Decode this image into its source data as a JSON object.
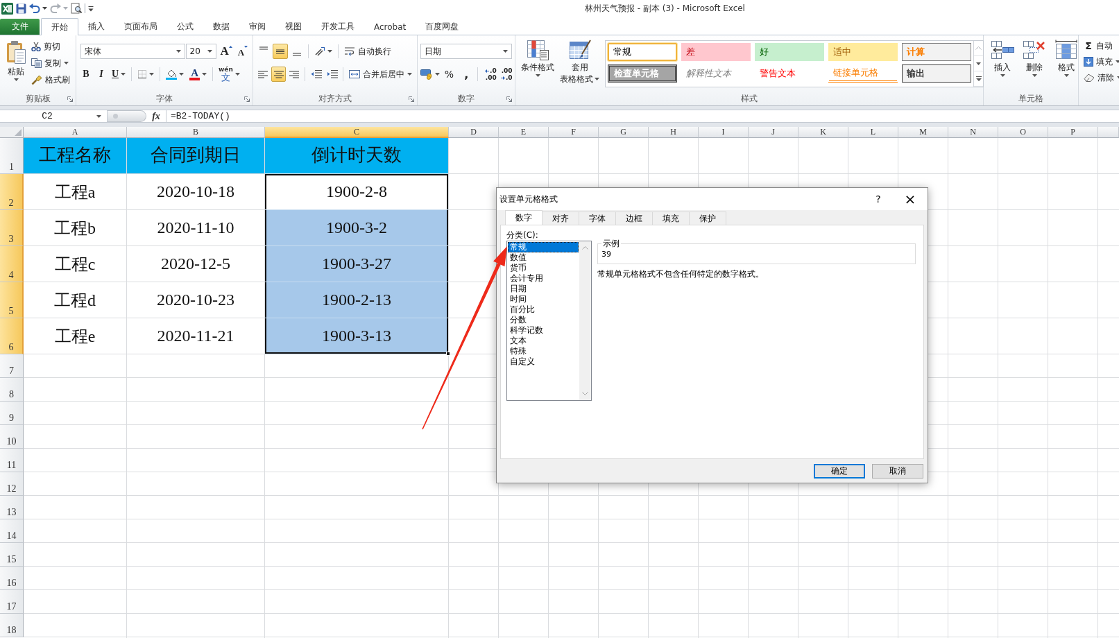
{
  "window": {
    "title": "林州天气预报 - 副本 (3)  -  Microsoft Excel"
  },
  "quick_access_toolbar": [
    {
      "kind": "save",
      "disabled": false
    },
    {
      "kind": "undo",
      "disabled": false
    },
    {
      "kind": "redo",
      "disabled": true
    },
    {
      "kind": "print_preview",
      "disabled": false
    }
  ],
  "ribbon_tabs": [
    {
      "label": "文件",
      "kind": "file",
      "selected": false
    },
    {
      "label": "开始",
      "kind": "tab",
      "selected": true
    },
    {
      "label": "插入",
      "kind": "tab",
      "selected": false
    },
    {
      "label": "页面布局",
      "kind": "tab",
      "selected": false
    },
    {
      "label": "公式",
      "kind": "tab",
      "selected": false
    },
    {
      "label": "数据",
      "kind": "tab",
      "selected": false
    },
    {
      "label": "审阅",
      "kind": "tab",
      "selected": false
    },
    {
      "label": "视图",
      "kind": "tab",
      "selected": false
    },
    {
      "label": "开发工具",
      "kind": "tab",
      "selected": false
    },
    {
      "label": "Acrobat",
      "kind": "tab",
      "selected": false
    },
    {
      "label": "百度网盘",
      "kind": "tab",
      "selected": false
    }
  ],
  "ribbon": {
    "clipboard": {
      "label": "剪贴板",
      "paste": "粘贴",
      "cut": "剪切",
      "copy": "复制",
      "format_painter": "格式刷"
    },
    "font": {
      "label": "字体",
      "font_name": "宋体",
      "font_size": "20",
      "grow_font": "A",
      "shrink_font": "A",
      "bold": "B",
      "italic": "I",
      "underline": "U",
      "font_color": "A",
      "phonetic": [
        "wén",
        "文"
      ]
    },
    "alignment": {
      "label": "对齐方式",
      "vertical": [
        {
          "kind": "top",
          "selected": false
        },
        {
          "kind": "middle",
          "selected": true
        },
        {
          "kind": "bottom",
          "selected": false
        }
      ],
      "horizontal": [
        {
          "kind": "left",
          "selected": false
        },
        {
          "kind": "center",
          "selected": true
        },
        {
          "kind": "right",
          "selected": false
        }
      ],
      "wrap_text": "自动换行",
      "merge_center": "合并后居中"
    },
    "number": {
      "label": "数字",
      "format": "日期",
      "percent": "%",
      "comma": ",",
      "increase_decimal": [
        ".0",
        ".00"
      ],
      "decrease_decimal": [
        ".00",
        ".0"
      ]
    },
    "styles": {
      "label": "样式",
      "conditional_formatting": "条件格式",
      "format_as_table": [
        "套用",
        "表格格式"
      ],
      "gallery": [
        {
          "label": "常规",
          "kind": "normal",
          "selected": true
        },
        {
          "label": "差",
          "kind": "bad",
          "selected": false
        },
        {
          "label": "好",
          "kind": "good",
          "selected": false
        },
        {
          "label": "适中",
          "kind": "neutral",
          "selected": false
        },
        {
          "label": "计算",
          "kind": "calculation",
          "selected": false
        },
        {
          "label": "检查单元格",
          "kind": "check",
          "selected": false
        },
        {
          "label": "解释性文本",
          "kind": "explanatory",
          "selected": false
        },
        {
          "label": "警告文本",
          "kind": "warning",
          "selected": false
        },
        {
          "label": "链接单元格",
          "kind": "linked",
          "selected": false
        },
        {
          "label": "输出",
          "kind": "output",
          "selected": false
        }
      ]
    },
    "cells": {
      "label": "单元格",
      "insert": "插入",
      "delete": "删除",
      "format": "格式"
    },
    "editing": {
      "autosum_symbol": "Σ",
      "autosum": "自动",
      "fill": "填充",
      "clear": "清除"
    }
  },
  "formula_bar": {
    "name_box": "C2",
    "insert_function": "fx",
    "formula": "=B2-TODAY()"
  },
  "sheet": {
    "columns": [
      {
        "label": "A",
        "selected": false
      },
      {
        "label": "B",
        "selected": false
      },
      {
        "label": "C",
        "selected": true
      },
      {
        "label": "D",
        "selected": false
      },
      {
        "label": "E",
        "selected": false
      },
      {
        "label": "F",
        "selected": false
      },
      {
        "label": "G",
        "selected": false
      },
      {
        "label": "H",
        "selected": false
      },
      {
        "label": "I",
        "selected": false
      },
      {
        "label": "J",
        "selected": false
      },
      {
        "label": "K",
        "selected": false
      },
      {
        "label": "L",
        "selected": false
      },
      {
        "label": "M",
        "selected": false
      },
      {
        "label": "N",
        "selected": false
      },
      {
        "label": "O",
        "selected": false
      },
      {
        "label": "P",
        "selected": false
      }
    ],
    "rows": [
      {
        "label": "1",
        "kind": "header",
        "selected": false,
        "cells": [
          {
            "text": "工程名称",
            "selected": false,
            "active": false
          },
          {
            "text": "合同到期日",
            "selected": false,
            "active": false
          },
          {
            "text": "倒计时天数",
            "selected": false,
            "active": false
          }
        ]
      },
      {
        "label": "2",
        "kind": "data",
        "selected": true,
        "cells": [
          {
            "text": "工程a",
            "selected": false,
            "active": false
          },
          {
            "text": "2020-10-18",
            "selected": false,
            "active": false
          },
          {
            "text": "1900-2-8",
            "selected": true,
            "active": true
          }
        ]
      },
      {
        "label": "3",
        "kind": "data",
        "selected": true,
        "cells": [
          {
            "text": "工程b",
            "selected": false,
            "active": false
          },
          {
            "text": "2020-11-10",
            "selected": false,
            "active": false
          },
          {
            "text": "1900-3-2",
            "selected": true,
            "active": false
          }
        ]
      },
      {
        "label": "4",
        "kind": "data",
        "selected": true,
        "cells": [
          {
            "text": "工程c",
            "selected": false,
            "active": false
          },
          {
            "text": "2020-12-5",
            "selected": false,
            "active": false
          },
          {
            "text": "1900-3-27",
            "selected": true,
            "active": false
          }
        ]
      },
      {
        "label": "5",
        "kind": "data",
        "selected": true,
        "cells": [
          {
            "text": "工程d",
            "selected": false,
            "active": false
          },
          {
            "text": "2020-10-23",
            "selected": false,
            "active": false
          },
          {
            "text": "1900-2-13",
            "selected": true,
            "active": false
          }
        ]
      },
      {
        "label": "6",
        "kind": "data",
        "selected": true,
        "cells": [
          {
            "text": "工程e",
            "selected": false,
            "active": false
          },
          {
            "text": "2020-11-21",
            "selected": false,
            "active": false
          },
          {
            "text": "1900-3-13",
            "selected": true,
            "active": false
          }
        ]
      },
      {
        "label": "7",
        "kind": "blank",
        "selected": false
      },
      {
        "label": "8",
        "kind": "blank",
        "selected": false
      },
      {
        "label": "9",
        "kind": "blank",
        "selected": false
      },
      {
        "label": "10",
        "kind": "blank",
        "selected": false
      },
      {
        "label": "11",
        "kind": "blank",
        "selected": false
      },
      {
        "label": "12",
        "kind": "blank",
        "selected": false
      },
      {
        "label": "13",
        "kind": "blank",
        "selected": false
      },
      {
        "label": "14",
        "kind": "blank",
        "selected": false
      },
      {
        "label": "15",
        "kind": "blank",
        "selected": false
      },
      {
        "label": "16",
        "kind": "blank",
        "selected": false
      },
      {
        "label": "17",
        "kind": "blank",
        "selected": false
      },
      {
        "label": "18",
        "kind": "blank",
        "selected": false
      }
    ]
  },
  "dialog": {
    "title": "设置单元格格式",
    "help": "?",
    "close": "×",
    "tabs": [
      {
        "label": "数字",
        "selected": true
      },
      {
        "label": "对齐",
        "selected": false
      },
      {
        "label": "字体",
        "selected": false
      },
      {
        "label": "边框",
        "selected": false
      },
      {
        "label": "填充",
        "selected": false
      },
      {
        "label": "保护",
        "selected": false
      }
    ],
    "category_label": "分类(C):",
    "categories": [
      {
        "label": "常规",
        "selected": true
      },
      {
        "label": "数值",
        "selected": false
      },
      {
        "label": "货币",
        "selected": false
      },
      {
        "label": "会计专用",
        "selected": false
      },
      {
        "label": "日期",
        "selected": false
      },
      {
        "label": "时间",
        "selected": false
      },
      {
        "label": "百分比",
        "selected": false
      },
      {
        "label": "分数",
        "selected": false
      },
      {
        "label": "科学记数",
        "selected": false
      },
      {
        "label": "文本",
        "selected": false
      },
      {
        "label": "特殊",
        "selected": false
      },
      {
        "label": "自定义",
        "selected": false
      }
    ],
    "sample_label": "示例",
    "sample_value": "39",
    "description": "常规单元格格式不包含任何特定的数字格式。",
    "buttons": [
      {
        "label": "确定",
        "kind": "default"
      },
      {
        "label": "取消",
        "kind": "normal"
      }
    ]
  }
}
